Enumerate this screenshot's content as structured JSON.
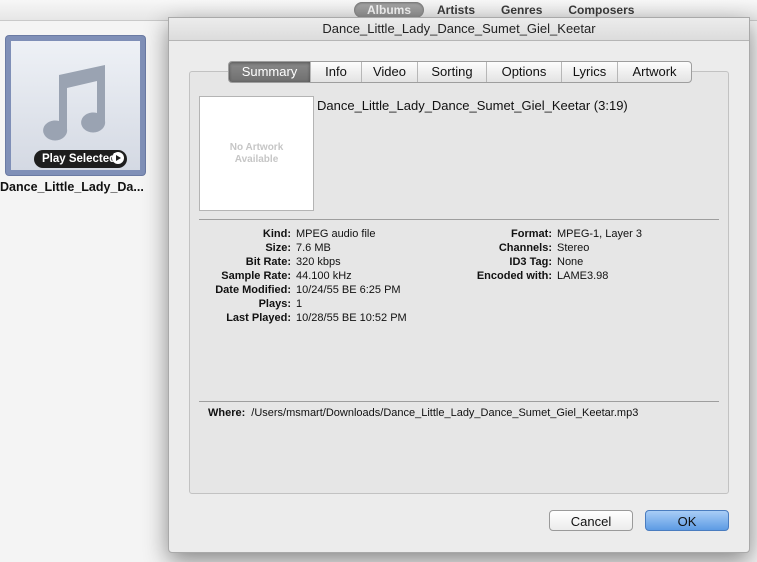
{
  "background": {
    "browse_tabs": [
      "Albums",
      "Artists",
      "Genres",
      "Composers"
    ],
    "active_browse_tab": "Albums",
    "album": {
      "play_button_label": "Play Selected",
      "title": "Dance_Little_Lady_Da..."
    }
  },
  "dialog": {
    "title": "Dance_Little_Lady_Dance_Sumet_Giel_Keetar",
    "tabs": [
      "Summary",
      "Info",
      "Video",
      "Sorting",
      "Options",
      "Lyrics",
      "Artwork"
    ],
    "active_tab": "Summary",
    "artwork_placeholder": "No Artwork\nAvailable",
    "track_heading": "Dance_Little_Lady_Dance_Sumet_Giel_Keetar (3:19)",
    "left_info": [
      {
        "key": "Kind:",
        "value": "MPEG audio file"
      },
      {
        "key": "Size:",
        "value": "7.6 MB"
      },
      {
        "key": "Bit Rate:",
        "value": "320 kbps"
      },
      {
        "key": "Sample Rate:",
        "value": "44.100 kHz"
      },
      {
        "key": "Date Modified:",
        "value": "10/24/55 BE 6:25 PM"
      },
      {
        "key": "Plays:",
        "value": "1"
      },
      {
        "key": "Last Played:",
        "value": "10/28/55 BE 10:52 PM"
      }
    ],
    "right_info": [
      {
        "key": "Format:",
        "value": "MPEG-1, Layer 3"
      },
      {
        "key": "Channels:",
        "value": "Stereo"
      },
      {
        "key": "ID3 Tag:",
        "value": "None"
      },
      {
        "key": "Encoded with:",
        "value": "LAME3.98"
      }
    ],
    "where": {
      "key": "Where:",
      "value": "/Users/msmart/Downloads/Dance_Little_Lady_Dance_Sumet_Giel_Keetar.mp3"
    },
    "buttons": {
      "cancel": "Cancel",
      "ok": "OK"
    }
  },
  "colors": {
    "ok_button": "#5d9be4",
    "album_frame": "#7f8fb7",
    "active_tab": "#777777"
  }
}
